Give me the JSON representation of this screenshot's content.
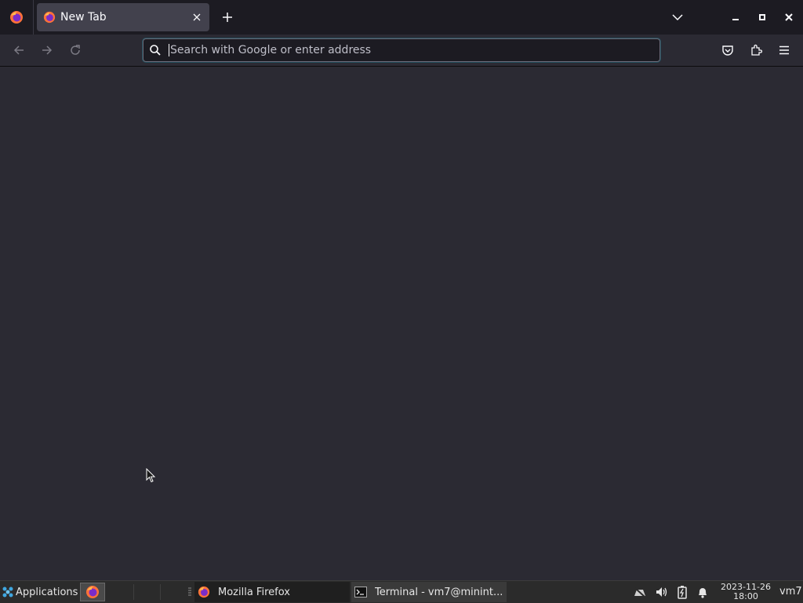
{
  "tabs": [
    {
      "title": "New Tab",
      "active": true
    }
  ],
  "urlbar": {
    "placeholder": "Search with Google or enter address",
    "value": ""
  },
  "taskbar": {
    "applications_label": "Applications",
    "tasks": [
      {
        "label": "Mozilla Firefox",
        "icon": "firefox-icon",
        "active": true
      },
      {
        "label": "Terminal - vm7@minint...",
        "icon": "terminal-icon",
        "active": false
      }
    ],
    "clock": {
      "date": "2023-11-26",
      "time": "18:00"
    },
    "user": "vm7"
  },
  "colors": {
    "content_bg": "#2b2a33",
    "tabstrip_bg": "#1c1b22",
    "active_tab_bg": "#42414d",
    "taskbar_bg": "#2b2b2b",
    "accent": "#00ddff"
  }
}
